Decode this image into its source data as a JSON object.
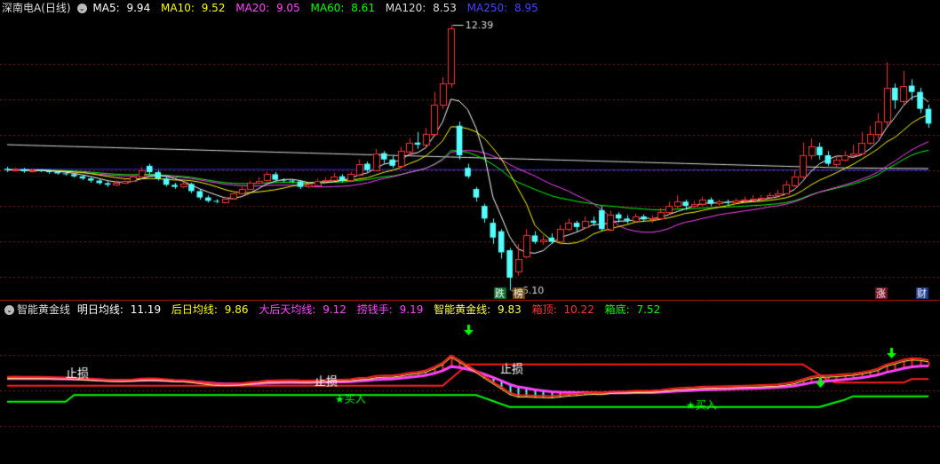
{
  "colors": {
    "bg": "#000000",
    "grid": "#7a1e1e",
    "separator": "#c01010",
    "up": "#ff3232",
    "down": "#54ffff",
    "ma5": "#ffffff",
    "ma10": "#ffff00",
    "ma20": "#ff44ff",
    "ma60": "#00ff00",
    "ma120": "#dddddd",
    "ma250": "#3333ff",
    "green": "#00ff00",
    "red": "#ff2020",
    "magenta": "#ff44ff",
    "cyan": "#54ffff",
    "yellow": "#ffff55"
  },
  "header_top": {
    "title": "深南电A(日线)",
    "ma5_label": "MA5:",
    "ma5_value": "9.94",
    "ma10_label": "MA10:",
    "ma10_value": "9.52",
    "ma20_label": "MA20:",
    "ma20_value": "9.05",
    "ma60_label": "MA60:",
    "ma60_value": "8.61",
    "ma120_label": "MA120:",
    "ma120_value": "8.53",
    "ma250_label": "MA250:",
    "ma250_value": "8.95"
  },
  "header_bottom": {
    "title": "智能黄金线",
    "l1_label": "明日均线:",
    "l1_value": "11.19",
    "l2_label": "后日均线:",
    "l2_value": "9.86",
    "l3_label": "大后天均线:",
    "l3_value": "9.12",
    "l4_label": "捞钱手:",
    "l4_value": "9.19",
    "l5_label": "智能黄金线:",
    "l5_value": "9.83",
    "l6_label": "箱顶:",
    "l6_value": "10.22",
    "l7_label": "箱底:",
    "l7_value": "7.52"
  },
  "annotations": {
    "high_label": "12.39",
    "low_label": "6.10",
    "tag_drop": "跌",
    "tag_list": "榜",
    "tag_rise": "涨",
    "tag_fin": "财",
    "stop_loss": "止损",
    "buy": "买入"
  },
  "chart_data": {
    "type": "candlestick",
    "candles": [
      [
        8.98,
        8.95,
        9.03,
        8.9
      ],
      [
        8.97,
        8.97,
        9.0,
        8.93
      ],
      [
        8.97,
        8.92,
        9.0,
        8.88
      ],
      [
        8.92,
        8.95,
        8.98,
        8.89
      ],
      [
        8.95,
        8.93,
        8.97,
        8.9
      ],
      [
        8.93,
        8.9,
        8.96,
        8.86
      ],
      [
        8.9,
        8.87,
        8.93,
        8.84
      ],
      [
        8.87,
        8.85,
        8.91,
        8.82
      ],
      [
        8.85,
        8.8,
        8.87,
        8.77
      ],
      [
        8.8,
        8.75,
        8.82,
        8.71
      ],
      [
        8.75,
        8.7,
        8.78,
        8.65
      ],
      [
        8.7,
        8.64,
        8.73,
        8.6
      ],
      [
        8.64,
        8.6,
        8.68,
        8.55
      ],
      [
        8.6,
        8.65,
        8.7,
        8.57
      ],
      [
        8.65,
        8.7,
        8.75,
        8.62
      ],
      [
        8.7,
        8.8,
        8.86,
        8.68
      ],
      [
        8.8,
        8.95,
        9.02,
        8.78
      ],
      [
        9.05,
        8.9,
        9.1,
        8.85
      ],
      [
        8.9,
        8.75,
        8.95,
        8.7
      ],
      [
        8.75,
        8.6,
        8.79,
        8.56
      ],
      [
        8.6,
        8.55,
        8.65,
        8.5
      ],
      [
        8.55,
        8.62,
        8.68,
        8.52
      ],
      [
        8.62,
        8.45,
        8.65,
        8.4
      ],
      [
        8.45,
        8.3,
        8.5,
        8.25
      ],
      [
        8.3,
        8.22,
        8.35,
        8.18
      ],
      [
        8.22,
        8.2,
        8.26,
        8.16
      ],
      [
        8.2,
        8.28,
        8.32,
        8.18
      ],
      [
        8.28,
        8.4,
        8.45,
        8.26
      ],
      [
        8.4,
        8.5,
        8.55,
        8.38
      ],
      [
        8.5,
        8.65,
        8.7,
        8.48
      ],
      [
        8.65,
        8.7,
        8.78,
        8.62
      ],
      [
        8.7,
        8.85,
        8.9,
        8.68
      ],
      [
        8.85,
        8.72,
        8.9,
        8.68
      ],
      [
        8.72,
        8.7,
        8.75,
        8.66
      ],
      [
        8.7,
        8.68,
        8.73,
        8.64
      ],
      [
        8.68,
        8.55,
        8.7,
        8.5
      ],
      [
        8.55,
        8.6,
        8.64,
        8.52
      ],
      [
        8.6,
        8.7,
        8.75,
        8.58
      ],
      [
        8.7,
        8.72,
        8.78,
        8.66
      ],
      [
        8.72,
        8.8,
        8.88,
        8.7
      ],
      [
        8.8,
        8.7,
        8.85,
        8.66
      ],
      [
        8.7,
        8.85,
        8.9,
        8.68
      ],
      [
        8.85,
        9.1,
        9.2,
        8.8
      ],
      [
        9.1,
        8.95,
        9.15,
        8.9
      ],
      [
        8.95,
        9.35,
        9.45,
        8.92
      ],
      [
        9.35,
        9.2,
        9.4,
        9.1
      ],
      [
        9.2,
        9.05,
        9.3,
        9.0
      ],
      [
        9.05,
        9.4,
        9.5,
        9.0
      ],
      [
        9.4,
        9.6,
        9.7,
        9.3
      ],
      [
        9.6,
        9.55,
        9.85,
        9.45
      ],
      [
        9.55,
        9.8,
        9.95,
        9.5
      ],
      [
        9.8,
        10.5,
        10.8,
        9.75
      ],
      [
        10.5,
        11.0,
        11.15,
        10.4
      ],
      [
        11.0,
        12.3,
        12.39,
        10.9
      ],
      [
        10.0,
        9.3,
        10.1,
        9.2
      ],
      [
        9.0,
        8.8,
        9.1,
        8.75
      ],
      [
        8.5,
        8.3,
        8.55,
        8.2
      ],
      [
        8.1,
        7.8,
        8.15,
        7.7
      ],
      [
        7.7,
        7.35,
        7.8,
        7.2
      ],
      [
        7.5,
        7.0,
        7.55,
        6.85
      ],
      [
        7.05,
        6.4,
        7.1,
        6.1
      ],
      [
        6.55,
        6.85,
        7.2,
        6.45
      ],
      [
        6.9,
        7.4,
        7.55,
        6.85
      ],
      [
        7.4,
        7.25,
        7.5,
        7.2
      ],
      [
        7.25,
        7.3,
        7.4,
        7.18
      ],
      [
        7.35,
        7.25,
        7.45,
        7.2
      ],
      [
        7.25,
        7.55,
        7.65,
        7.2
      ],
      [
        7.55,
        7.7,
        7.8,
        7.5
      ],
      [
        7.7,
        7.6,
        7.75,
        7.5
      ],
      [
        7.6,
        7.75,
        7.85,
        7.55
      ],
      [
        7.75,
        7.7,
        7.85,
        7.62
      ],
      [
        8.0,
        7.55,
        8.1,
        7.5
      ],
      [
        7.55,
        7.9,
        7.98,
        7.5
      ],
      [
        7.9,
        7.8,
        7.95,
        7.7
      ],
      [
        7.8,
        7.75,
        7.88,
        7.68
      ],
      [
        7.75,
        7.85,
        7.92,
        7.7
      ],
      [
        7.85,
        7.78,
        7.9,
        7.72
      ],
      [
        7.78,
        7.8,
        7.88,
        7.7
      ],
      [
        7.8,
        7.95,
        8.05,
        7.76
      ],
      [
        7.95,
        8.1,
        8.2,
        7.9
      ],
      [
        8.1,
        8.2,
        8.35,
        8.05
      ],
      [
        8.2,
        8.1,
        8.25,
        8.0
      ],
      [
        8.1,
        8.15,
        8.22,
        8.05
      ],
      [
        8.15,
        8.25,
        8.32,
        8.1
      ],
      [
        8.25,
        8.15,
        8.3,
        8.1
      ],
      [
        8.15,
        8.2,
        8.25,
        8.1
      ],
      [
        8.2,
        8.18,
        8.25,
        8.12
      ],
      [
        8.18,
        8.22,
        8.28,
        8.15
      ],
      [
        8.22,
        8.25,
        8.32,
        8.18
      ],
      [
        8.25,
        8.28,
        8.35,
        8.2
      ],
      [
        8.28,
        8.3,
        8.36,
        8.24
      ],
      [
        8.3,
        8.35,
        8.42,
        8.27
      ],
      [
        8.35,
        8.4,
        8.48,
        8.3
      ],
      [
        8.4,
        8.6,
        8.7,
        8.38
      ],
      [
        8.6,
        8.8,
        8.95,
        8.55
      ],
      [
        8.8,
        9.3,
        9.6,
        8.75
      ],
      [
        9.3,
        9.5,
        9.7,
        9.2
      ],
      [
        9.5,
        9.3,
        9.6,
        9.2
      ],
      [
        9.3,
        9.1,
        9.4,
        9.05
      ],
      [
        9.1,
        9.2,
        9.3,
        9.0
      ],
      [
        9.2,
        9.3,
        9.4,
        9.15
      ],
      [
        9.3,
        9.35,
        9.55,
        9.25
      ],
      [
        9.35,
        9.6,
        9.85,
        9.3
      ],
      [
        9.6,
        9.8,
        10.0,
        9.55
      ],
      [
        9.8,
        10.1,
        10.3,
        9.7
      ],
      [
        10.1,
        10.9,
        11.5,
        10.0
      ],
      [
        10.9,
        10.6,
        11.0,
        10.4
      ],
      [
        10.6,
        10.95,
        11.3,
        10.5
      ],
      [
        10.95,
        10.8,
        11.1,
        10.6
      ],
      [
        10.8,
        10.4,
        10.9,
        10.3
      ],
      [
        10.4,
        10.05,
        10.5,
        9.95
      ]
    ],
    "y_range": [
      6.0,
      12.6
    ],
    "high": 12.39,
    "low": 6.1
  }
}
